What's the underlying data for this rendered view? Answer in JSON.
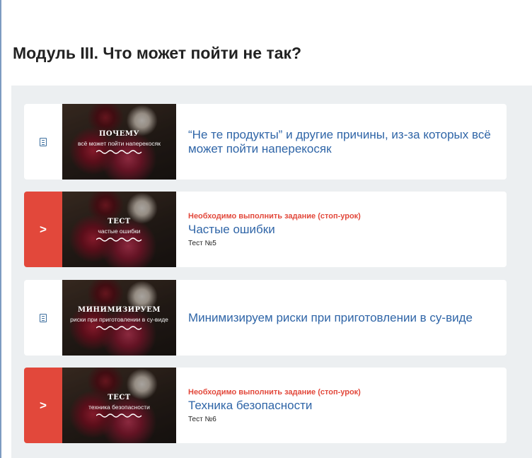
{
  "module": {
    "title": "Модуль III. Что может пойти не так?"
  },
  "lessons": [
    {
      "thumb_title": "почему",
      "thumb_subtitle": "всё может пойти наперекосяк",
      "stop_note": "",
      "title": "“Не те продукты” и другие причины, из-за которых всё может пойти наперекосяк",
      "test_label": "",
      "status_icon": "document-icon",
      "locked": false
    },
    {
      "thumb_title": "тест",
      "thumb_subtitle": "частые ошибки",
      "stop_note": "Необходимо выполнить задание (стоп-урок)",
      "title": "Частые ошибки",
      "test_label": "Тест №5",
      "status_icon": "chevron-right-icon",
      "locked": true
    },
    {
      "thumb_title": "минимизируем",
      "thumb_subtitle": "риски при приготовлении в су-виде",
      "stop_note": "",
      "title": "Минимизируем риски при приготовлении в су-виде",
      "test_label": "",
      "status_icon": "document-icon",
      "locked": false
    },
    {
      "thumb_title": "тест",
      "thumb_subtitle": "техника безопасности",
      "stop_note": "Необходимо выполнить задание (стоп-урок)",
      "title": "Техника безопасности",
      "test_label": "Тест №6",
      "status_icon": "chevron-right-icon",
      "locked": true
    }
  ],
  "colors": {
    "alert": "#e2483b",
    "link": "#2f65a7",
    "panel": "#eceff1"
  }
}
